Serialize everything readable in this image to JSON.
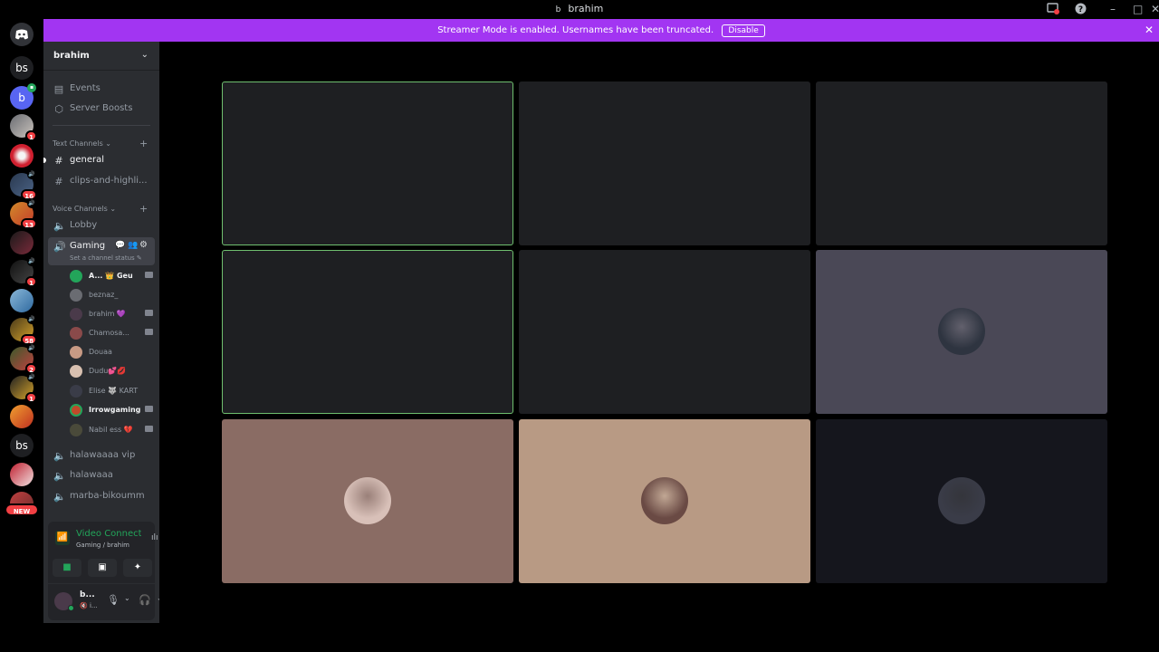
{
  "window": {
    "title": "brahim",
    "title_glyph": "b",
    "minimize": "–",
    "maximize": "□",
    "close": "✕"
  },
  "banner": {
    "text": "Streamer Mode is enabled. Usernames have been truncated.",
    "button": "Disable",
    "close": "✕"
  },
  "servers": {
    "top_text": "bs",
    "home_letter": "b",
    "badges": [
      "1",
      "16",
      "13",
      "1",
      "58",
      "2",
      "1"
    ],
    "mid_text": "bs",
    "new_label": "NEW"
  },
  "sidebar": {
    "server_name": "brahim",
    "chevron": "⌄",
    "events_label": "Events",
    "boosts_label": "Server Boosts",
    "text_category": "Text Channels",
    "voice_category": "Voice Channels",
    "category_caret": "⌄",
    "add_symbol": "+",
    "text_channels": [
      {
        "label": "general"
      },
      {
        "label": "clips-and-highli..."
      }
    ],
    "voice_channels": [
      {
        "label": "Lobby"
      },
      {
        "label": "Gaming"
      }
    ],
    "channel_status": "Set a channel status",
    "members": [
      {
        "name": "A... 👑 Geu"
      },
      {
        "name": "beznaz_"
      },
      {
        "name": "brahim 💜"
      },
      {
        "name": "Chamosa..."
      },
      {
        "name": "Douaa"
      },
      {
        "name": "Dudu💕💋"
      },
      {
        "name": "Elise 🐺 KART"
      },
      {
        "name": "Irrowgaming"
      },
      {
        "name": "Nabil ess 💔"
      }
    ],
    "more_voice": [
      {
        "label": "halawaaaa vip"
      },
      {
        "label": "halawaaa"
      },
      {
        "label": "marba-bikoumm"
      }
    ]
  },
  "voice_panel": {
    "status": "Video Connected",
    "location": "Gaming / brahim",
    "user_name": "b...",
    "user_sub": "🔇 i..."
  },
  "grid": {
    "tiles": [
      {
        "speaking": true,
        "bg": "#1e1f22",
        "avatar": null
      },
      {
        "speaking": false,
        "bg": "#1e1f22",
        "avatar": null
      },
      {
        "speaking": false,
        "bg": "#1e1f22",
        "avatar": null
      },
      {
        "speaking": true,
        "bg": "#1e1f22",
        "avatar": null
      },
      {
        "speaking": false,
        "bg": "#1e1f22",
        "avatar": null
      },
      {
        "speaking": false,
        "bg": "#4a4856",
        "avatar": "#2e3440"
      },
      {
        "speaking": false,
        "bg": "#8a6c64",
        "avatar": "#d8c0b8"
      },
      {
        "speaking": false,
        "bg": "#b89a84",
        "avatar": "#6a4a44"
      },
      {
        "speaking": false,
        "bg": "#15161d",
        "avatar": "#3a3c48"
      }
    ]
  },
  "colors": {
    "accent": "#a235f2",
    "speaking_border": "#6fbf6f",
    "badge": "#f23f43",
    "connected_green": "#23a55a"
  }
}
